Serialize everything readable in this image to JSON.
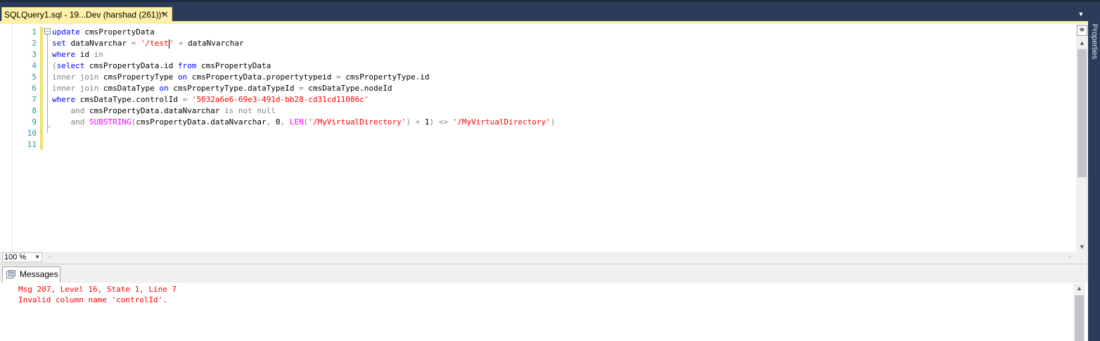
{
  "tab": {
    "title": "SQLQuery1.sql - 19...Dev (harshad (261))*",
    "close_glyph": "✕"
  },
  "side_panel_label": "Properties",
  "editor": {
    "line_numbers": [
      "1",
      "2",
      "3",
      "4",
      "5",
      "6",
      "7",
      "8",
      "9",
      "10",
      "11"
    ],
    "lines": [
      [
        {
          "t": "update",
          "c": "kw"
        },
        {
          "t": " cmsPropertyData",
          "c": ""
        }
      ],
      [
        {
          "t": "set",
          "c": "kw"
        },
        {
          "t": " dataNvarchar ",
          "c": ""
        },
        {
          "t": "=",
          "c": "gray"
        },
        {
          "t": " ",
          "c": ""
        },
        {
          "t": "'/test",
          "c": "str"
        },
        {
          "t": "",
          "c": "caret"
        },
        {
          "t": "'",
          "c": "str"
        },
        {
          "t": " ",
          "c": ""
        },
        {
          "t": "+",
          "c": "gray"
        },
        {
          "t": " dataNvarchar",
          "c": ""
        }
      ],
      [
        {
          "t": "where",
          "c": "kw"
        },
        {
          "t": " id ",
          "c": ""
        },
        {
          "t": "in",
          "c": "gray"
        }
      ],
      [
        {
          "t": "(",
          "c": "gray"
        },
        {
          "t": "select",
          "c": "kw"
        },
        {
          "t": " cmsPropertyData.id ",
          "c": ""
        },
        {
          "t": "from",
          "c": "kw"
        },
        {
          "t": " cmsPropertyData",
          "c": ""
        }
      ],
      [
        {
          "t": "inner join",
          "c": "gray"
        },
        {
          "t": " cmsPropertyType ",
          "c": ""
        },
        {
          "t": "on",
          "c": "kw"
        },
        {
          "t": " cmsPropertyData.propertytypeid ",
          "c": ""
        },
        {
          "t": "=",
          "c": "gray"
        },
        {
          "t": " cmsPropertyType.id",
          "c": ""
        }
      ],
      [
        {
          "t": "inner join",
          "c": "gray"
        },
        {
          "t": " cmsDataType ",
          "c": ""
        },
        {
          "t": "on",
          "c": "kw"
        },
        {
          "t": " cmsPropertyType.dataTypeId ",
          "c": ""
        },
        {
          "t": "=",
          "c": "gray"
        },
        {
          "t": " cmsDataType.nodeId",
          "c": ""
        }
      ],
      [
        {
          "t": "where",
          "c": "kw"
        },
        {
          "t": " cmsDataType.controlId ",
          "c": ""
        },
        {
          "t": "=",
          "c": "gray"
        },
        {
          "t": " ",
          "c": ""
        },
        {
          "t": "'5032a6e6-69e3-491d-bb28-cd31cd11086c'",
          "c": "str"
        }
      ],
      [
        {
          "t": "    ",
          "c": ""
        },
        {
          "t": "and",
          "c": "gray"
        },
        {
          "t": " cmsPropertyData.dataNvarchar ",
          "c": ""
        },
        {
          "t": "is not null",
          "c": "gray"
        }
      ],
      [
        {
          "t": "    ",
          "c": ""
        },
        {
          "t": "and",
          "c": "gray"
        },
        {
          "t": " ",
          "c": ""
        },
        {
          "t": "SUBSTRING",
          "c": "fn"
        },
        {
          "t": "(",
          "c": "gray"
        },
        {
          "t": "cmsPropertyData.dataNvarchar",
          "c": ""
        },
        {
          "t": ",",
          "c": "gray"
        },
        {
          "t": " 0",
          "c": ""
        },
        {
          "t": ",",
          "c": "gray"
        },
        {
          "t": " ",
          "c": ""
        },
        {
          "t": "LEN",
          "c": "fn"
        },
        {
          "t": "(",
          "c": "gray"
        },
        {
          "t": "'/MyVirtualDirectory'",
          "c": "str"
        },
        {
          "t": ")",
          "c": "gray"
        },
        {
          "t": " ",
          "c": ""
        },
        {
          "t": "+",
          "c": "gray"
        },
        {
          "t": " 1",
          "c": ""
        },
        {
          "t": ")",
          "c": "gray"
        },
        {
          "t": " ",
          "c": ""
        },
        {
          "t": "<>",
          "c": "gray"
        },
        {
          "t": " ",
          "c": ""
        },
        {
          "t": "'/MyVirtualDirectory'",
          "c": "str"
        },
        {
          "t": ")",
          "c": "gray"
        }
      ],
      [],
      []
    ]
  },
  "zoom": {
    "value": "100 %"
  },
  "results": {
    "tab_label": "Messages",
    "messages": [
      "Msg 207, Level 16, State 1, Line 7",
      "Invalid column name 'controlId'."
    ]
  },
  "colors": {
    "tab_active": "#fff1a8",
    "chrome": "#2b3c5a",
    "keyword": "#0000ff",
    "string": "#ff0000",
    "operator": "#808080",
    "function": "#ff00ff",
    "line_number": "#2b91af",
    "error": "#ff0000"
  }
}
